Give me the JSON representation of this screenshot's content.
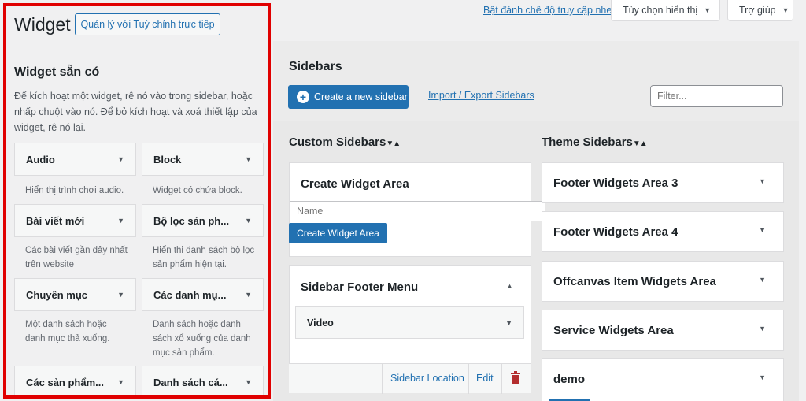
{
  "topbar": {
    "a11y_link": "Bật đánh chế độ truy cập nhe",
    "screen_options": "Tùy chọn hiển thị",
    "help": "Trợ giúp"
  },
  "left": {
    "title": "Widget",
    "customize_button": "Quản lý với Tuỳ chỉnh trực tiếp",
    "available_title": "Widget sẵn có",
    "available_desc": "Để kích hoạt một widget, rê nó vào trong sidebar, hoặc nhấp chuột vào nó. Để bỏ kích hoạt và xoá thiết lập của widget, rê nó lại.",
    "widgets": [
      {
        "name": "Audio",
        "desc": "Hiển thị trình chơi audio."
      },
      {
        "name": "Block",
        "desc": "Widget có chứa block."
      },
      {
        "name": "Bài viết mới",
        "desc": "Các bài viết gần đây nhất trên website"
      },
      {
        "name": "Bộ lọc sản ph...",
        "desc": "Hiển thị danh sách bộ lọc sản phẩm hiện tại."
      },
      {
        "name": "Chuyên mục",
        "desc": "Một danh sách hoặc danh mục thả xuống."
      },
      {
        "name": "Các danh mụ...",
        "desc": "Danh sách hoặc danh sách xổ xuống của danh mục sản phẩm."
      },
      {
        "name": "Các sản phẩm...",
        "desc": ""
      },
      {
        "name": "Danh sách cá...",
        "desc": ""
      }
    ]
  },
  "main": {
    "sidebars_title": "Sidebars",
    "create_sidebar_button": "Create a new sidebar",
    "import_export_link": "Import / Export Sidebars",
    "filter_placeholder": "Filter...",
    "custom_col_title": "Custom Sidebars",
    "theme_col_title": "Theme Sidebars",
    "sort_glyph": "▼▲",
    "create_widget_area": {
      "title": "Create Widget Area",
      "name_placeholder": "Name",
      "button": "Create Widget Area"
    },
    "sidebar_footer_menu": {
      "title": "Sidebar Footer Menu",
      "widget": "Video",
      "location_link": "Sidebar Location",
      "edit_link": "Edit"
    },
    "theme_sidebars": [
      "Footer Widgets Area 3",
      "Footer Widgets Area 4",
      "Offcanvas Item Widgets Area",
      "Service Widgets Area",
      "demo"
    ]
  },
  "colors": {
    "accent": "#2271b1",
    "highlight_frame": "#e00000",
    "delete": "#b32d2e"
  }
}
